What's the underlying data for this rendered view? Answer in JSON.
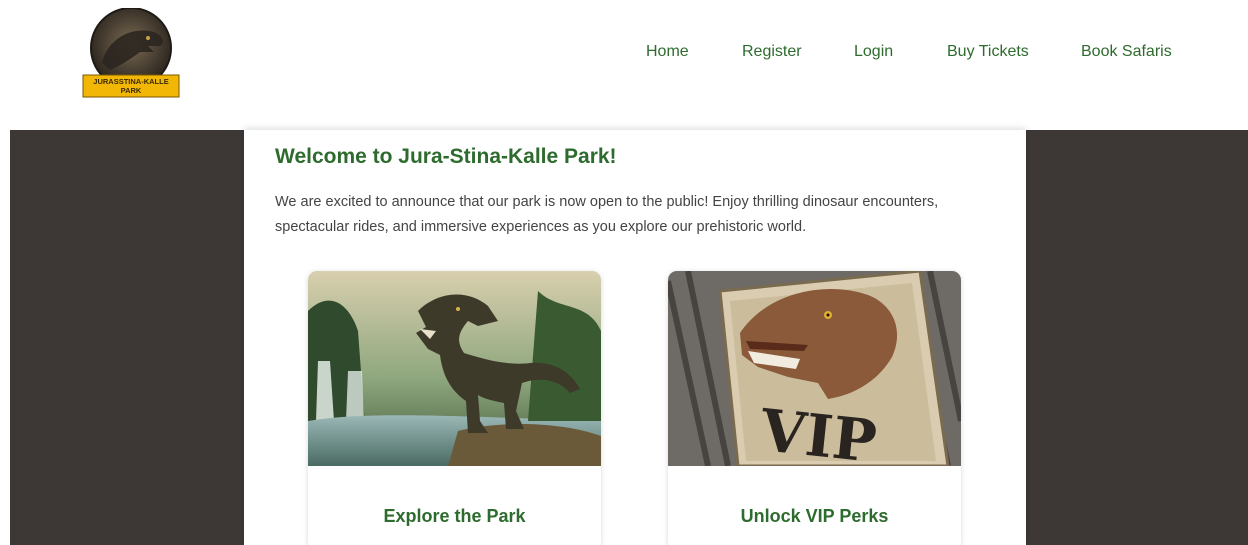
{
  "logo": {
    "text_line1": "JURASSTINA-KALLE",
    "text_line2": "PARK"
  },
  "nav": {
    "items": [
      {
        "label": "Home"
      },
      {
        "label": "Register"
      },
      {
        "label": "Login"
      },
      {
        "label": "Buy Tickets"
      },
      {
        "label": "Book Safaris"
      }
    ]
  },
  "main": {
    "title": "Welcome to Jura-Stina-Kalle Park!",
    "intro": "We are excited to announce that our park is now open to the public! Enjoy thrilling dinosaur encounters, spectacular rides, and immersive experiences as you explore our prehistoric world.",
    "cards": [
      {
        "title": "Explore the Park",
        "image": "t-rex-jungle-waterfall-image"
      },
      {
        "title": "Unlock VIP Perks",
        "image": "dinosaur-vip-ticket-image",
        "image_text": "VIP"
      }
    ]
  },
  "colors": {
    "accent": "#2e6b2e",
    "page_bg": "#3d3836",
    "logo_badge": "#f2b705"
  }
}
